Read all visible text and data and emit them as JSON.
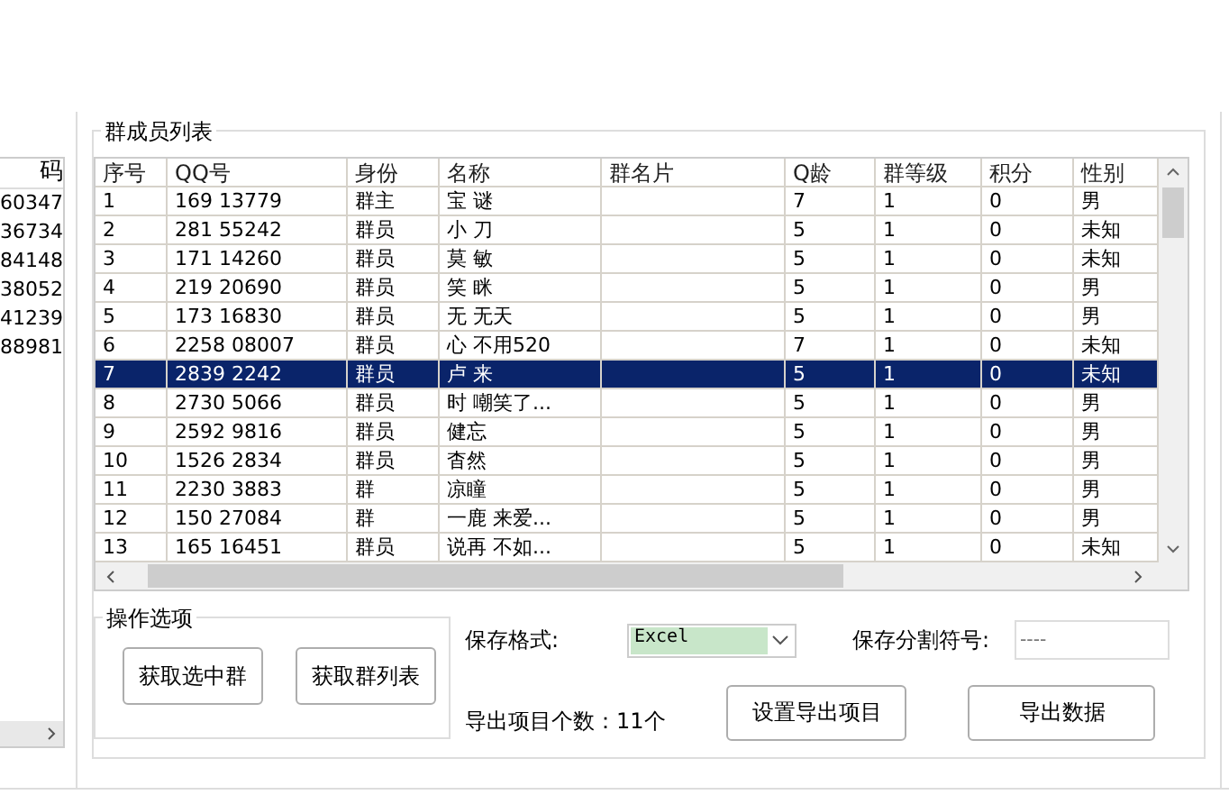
{
  "left_list": {
    "header": "码",
    "rows": [
      "60347",
      "36734",
      "84148",
      "38052",
      "41239",
      "88981"
    ]
  },
  "member_list": {
    "title": "群成员列表",
    "columns": [
      "序号",
      "QQ号",
      "身份",
      "名称",
      "群名片",
      "Q龄",
      "群等级",
      "积分",
      "性别"
    ],
    "rows": [
      {
        "cells": [
          "1",
          "169 13779",
          "群主",
          "宝 谜",
          "",
          "7",
          "1",
          "0",
          "男"
        ],
        "selected": false
      },
      {
        "cells": [
          "2",
          "281 55242",
          "群员",
          "小 刀",
          "",
          "5",
          "1",
          "0",
          "未知"
        ],
        "selected": false
      },
      {
        "cells": [
          "3",
          "171 14260",
          "群员",
          "莫 敏",
          "",
          "5",
          "1",
          "0",
          "未知"
        ],
        "selected": false
      },
      {
        "cells": [
          "4",
          "219 20690",
          "群员",
          "笑 眯",
          "",
          "5",
          "1",
          "0",
          "男"
        ],
        "selected": false
      },
      {
        "cells": [
          "5",
          "173 16830",
          "群员",
          "无 无天",
          "",
          "5",
          "1",
          "0",
          "男"
        ],
        "selected": false
      },
      {
        "cells": [
          "6",
          "2258 08007",
          "群员",
          "心 不用520",
          "",
          "7",
          "1",
          "0",
          "未知"
        ],
        "selected": false
      },
      {
        "cells": [
          "7",
          "2839 2242",
          "群员",
          "卢 来",
          "",
          "5",
          "1",
          "0",
          "未知"
        ],
        "selected": true
      },
      {
        "cells": [
          "8",
          "2730 5066",
          "群员",
          "时 嘲笑了...",
          "",
          "5",
          "1",
          "0",
          "男"
        ],
        "selected": false
      },
      {
        "cells": [
          "9",
          "2592 9816",
          "群员",
          "健忘",
          "",
          "5",
          "1",
          "0",
          "男"
        ],
        "selected": false
      },
      {
        "cells": [
          "10",
          "1526 2834",
          "群员",
          "杳然",
          "",
          "5",
          "1",
          "0",
          "男"
        ],
        "selected": false
      },
      {
        "cells": [
          "11",
          "2230 3883",
          "群",
          "凉瞳",
          "",
          "5",
          "1",
          "0",
          "男"
        ],
        "selected": false
      },
      {
        "cells": [
          "12",
          "150 27084",
          "群",
          "一鹿 来爱...",
          "",
          "5",
          "1",
          "0",
          "男"
        ],
        "selected": false
      },
      {
        "cells": [
          "13",
          "165 16451",
          "群员",
          "说再 不如...",
          "",
          "5",
          "1",
          "0",
          "未知"
        ],
        "selected": false
      }
    ]
  },
  "options": {
    "title": "操作选项",
    "buttons": [
      "获取选中群",
      "获取群列表"
    ]
  },
  "export": {
    "format_label": "保存格式:",
    "format_value": "Excel",
    "separator_label": "保存分割符号:",
    "separator_placeholder": "----",
    "count_text": "导出项目个数：11个",
    "buttons": [
      "设置导出项目",
      "导出数据"
    ]
  }
}
